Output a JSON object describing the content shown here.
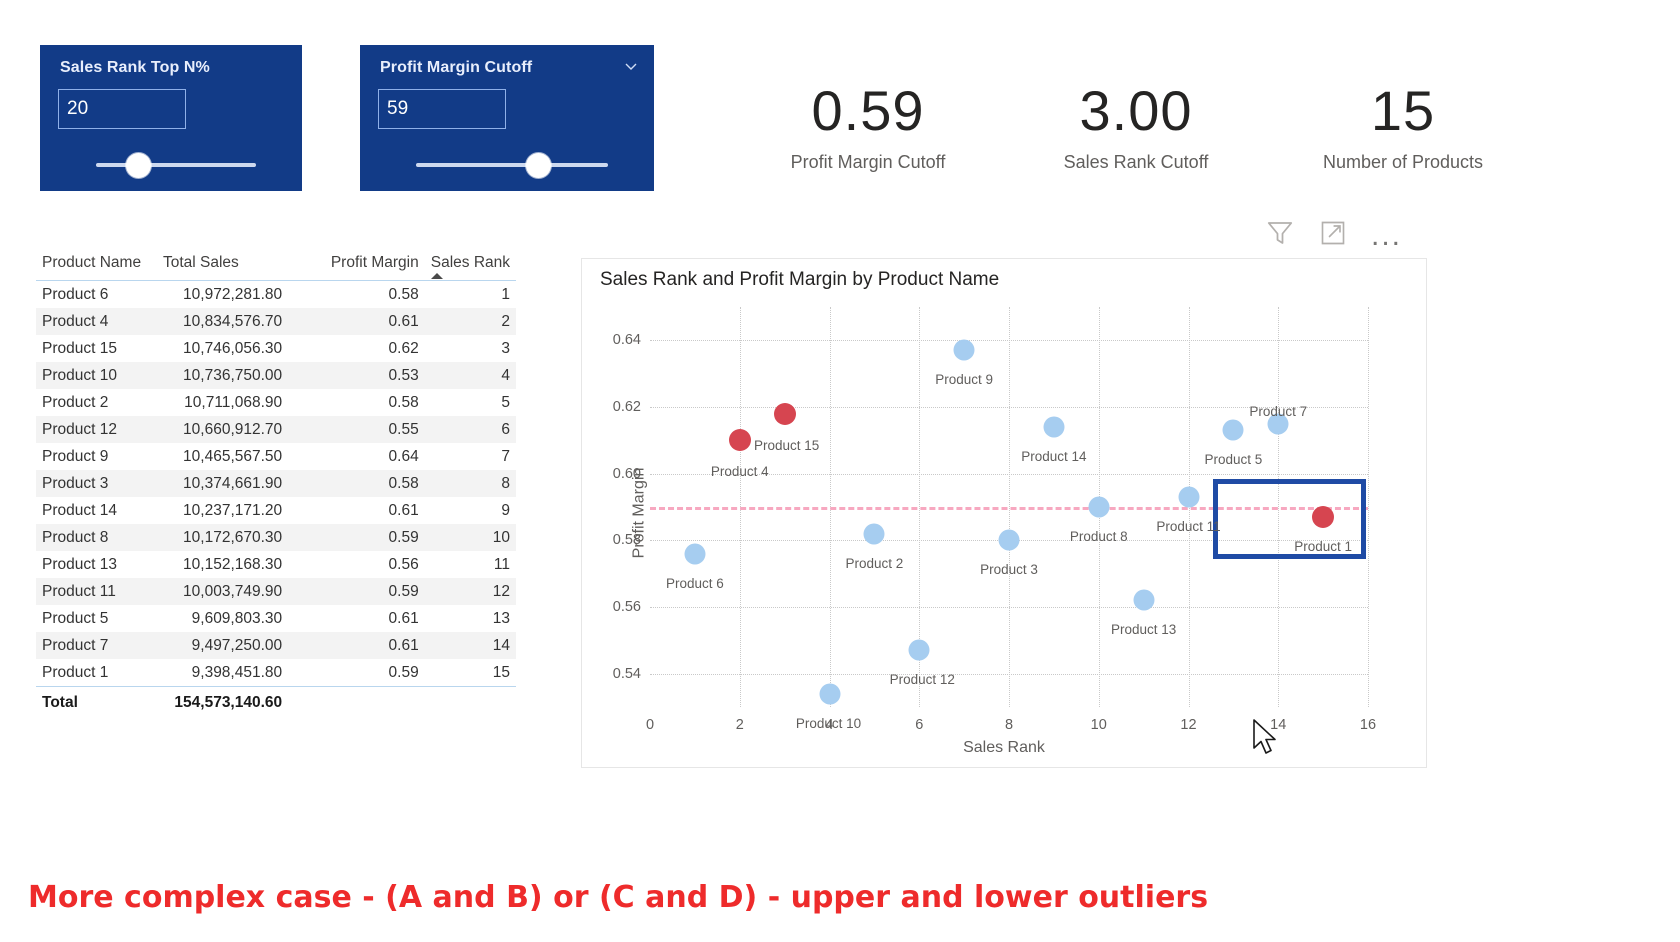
{
  "slicers": [
    {
      "name": "sales-rank-top-n",
      "title": "Sales Rank Top N%",
      "value": "20",
      "thumb_pct": 22,
      "has_chevron": false
    },
    {
      "name": "profit-margin-cutoff",
      "title": "Profit Margin Cutoff",
      "value": "59",
      "thumb_pct": 58,
      "has_chevron": true,
      "chevron_icon": "chevron-down-icon"
    }
  ],
  "kpis": [
    {
      "value": "0.59",
      "label": "Profit Margin Cutoff"
    },
    {
      "value": "3.00",
      "label": "Sales Rank Cutoff"
    },
    {
      "value": "15",
      "label": "Number of Products"
    }
  ],
  "table": {
    "columns": [
      "Product Name",
      "Total Sales",
      "Profit Margin",
      "Sales Rank"
    ],
    "sorted_column": "Sales Rank",
    "sort_direction": "ascending",
    "rows": [
      {
        "name": "Product 6",
        "sales": "10,972,281.80",
        "margin": "0.58",
        "rank": "1"
      },
      {
        "name": "Product 4",
        "sales": "10,834,576.70",
        "margin": "0.61",
        "rank": "2"
      },
      {
        "name": "Product 15",
        "sales": "10,746,056.30",
        "margin": "0.62",
        "rank": "3"
      },
      {
        "name": "Product 10",
        "sales": "10,736,750.00",
        "margin": "0.53",
        "rank": "4"
      },
      {
        "name": "Product 2",
        "sales": "10,711,068.90",
        "margin": "0.58",
        "rank": "5"
      },
      {
        "name": "Product 12",
        "sales": "10,660,912.70",
        "margin": "0.55",
        "rank": "6"
      },
      {
        "name": "Product 9",
        "sales": "10,465,567.50",
        "margin": "0.64",
        "rank": "7"
      },
      {
        "name": "Product 3",
        "sales": "10,374,661.90",
        "margin": "0.58",
        "rank": "8"
      },
      {
        "name": "Product 14",
        "sales": "10,237,171.20",
        "margin": "0.61",
        "rank": "9"
      },
      {
        "name": "Product 8",
        "sales": "10,172,670.30",
        "margin": "0.59",
        "rank": "10"
      },
      {
        "name": "Product 13",
        "sales": "10,152,168.30",
        "margin": "0.56",
        "rank": "11"
      },
      {
        "name": "Product 11",
        "sales": "10,003,749.90",
        "margin": "0.59",
        "rank": "12"
      },
      {
        "name": "Product 5",
        "sales": "9,609,803.30",
        "margin": "0.61",
        "rank": "13"
      },
      {
        "name": "Product 7",
        "sales": "9,497,250.00",
        "margin": "0.61",
        "rank": "14"
      },
      {
        "name": "Product 1",
        "sales": "9,398,451.80",
        "margin": "0.59",
        "rank": "15"
      }
    ],
    "total": {
      "label": "Total",
      "sales": "154,573,140.60",
      "margin": "",
      "rank": ""
    }
  },
  "chart_toolbar": {
    "filter_icon": "filter-icon",
    "focus_icon": "focus-mode-icon",
    "more_label": "..."
  },
  "chart_data": {
    "type": "scatter",
    "title": "Sales Rank and Profit Margin by Product Name",
    "xlabel": "Sales Rank",
    "ylabel": "Profit Margin",
    "xlim": [
      0,
      16
    ],
    "ylim": [
      0.53,
      0.65
    ],
    "xticks": [
      0,
      2,
      4,
      6,
      8,
      10,
      12,
      14,
      16
    ],
    "yticks": [
      0.64,
      0.62,
      0.6,
      0.58,
      0.56,
      0.54
    ],
    "ytick_labels": [
      "0.64",
      "0.62",
      "0.60",
      "0.58",
      "0.56",
      "0.54"
    ],
    "grid": "dotted",
    "legend": "none",
    "reference_line": {
      "value": 0.59,
      "color": "#f7a8c0",
      "style": "dashed",
      "label": "Profit Margin Cutoff"
    },
    "colors": {
      "normal": "#a6cdf0",
      "highlight": "#d64550"
    },
    "points": [
      {
        "label": "Product 6",
        "x": 1,
        "y": 0.576,
        "color": "normal",
        "label_dx": 0,
        "label_dy": 22
      },
      {
        "label": "Product 4",
        "x": 2,
        "y": 0.61,
        "color": "highlight",
        "label_dx": 0,
        "label_dy": 24
      },
      {
        "label": "Product 15",
        "x": 3,
        "y": 0.618,
        "color": "highlight",
        "label_dx": 2,
        "label_dy": 24
      },
      {
        "label": "Product 10",
        "x": 4,
        "y": 0.534,
        "color": "normal",
        "label_dx": -1,
        "label_dy": 22
      },
      {
        "label": "Product 2",
        "x": 5,
        "y": 0.582,
        "color": "normal",
        "label_dx": 0,
        "label_dy": 22
      },
      {
        "label": "Product 12",
        "x": 6,
        "y": 0.547,
        "color": "normal",
        "label_dx": 3,
        "label_dy": 22
      },
      {
        "label": "Product 9",
        "x": 7,
        "y": 0.637,
        "color": "normal",
        "label_dx": 0,
        "label_dy": 22
      },
      {
        "label": "Product 3",
        "x": 8,
        "y": 0.58,
        "color": "normal",
        "label_dx": 0,
        "label_dy": 22
      },
      {
        "label": "Product 14",
        "x": 9,
        "y": 0.614,
        "color": "normal",
        "label_dx": 0,
        "label_dy": 22
      },
      {
        "label": "Product 8",
        "x": 10,
        "y": 0.59,
        "color": "normal",
        "label_dx": 0,
        "label_dy": 22
      },
      {
        "label": "Product 13",
        "x": 11,
        "y": 0.562,
        "color": "normal",
        "label_dx": 0,
        "label_dy": 22
      },
      {
        "label": "Product 11",
        "x": 12,
        "y": 0.593,
        "color": "normal",
        "label_dx": 0,
        "label_dy": 22
      },
      {
        "label": "Product 5",
        "x": 13,
        "y": 0.613,
        "color": "normal",
        "label_dx": 0,
        "label_dy": 22
      },
      {
        "label": "Product 7",
        "x": 14,
        "y": 0.615,
        "color": "normal",
        "label_dx": 0,
        "label_dy": -20
      },
      {
        "label": "Product 1",
        "x": 15,
        "y": 0.587,
        "color": "highlight",
        "label_dx": 0,
        "label_dy": 22
      }
    ],
    "highlight_box": {
      "x0": 12.55,
      "x1": 15.95,
      "y0": 0.5745,
      "y1": 0.5985
    }
  },
  "caption": "More complex case - (A and B) or (C and D) - upper and lower outliers"
}
